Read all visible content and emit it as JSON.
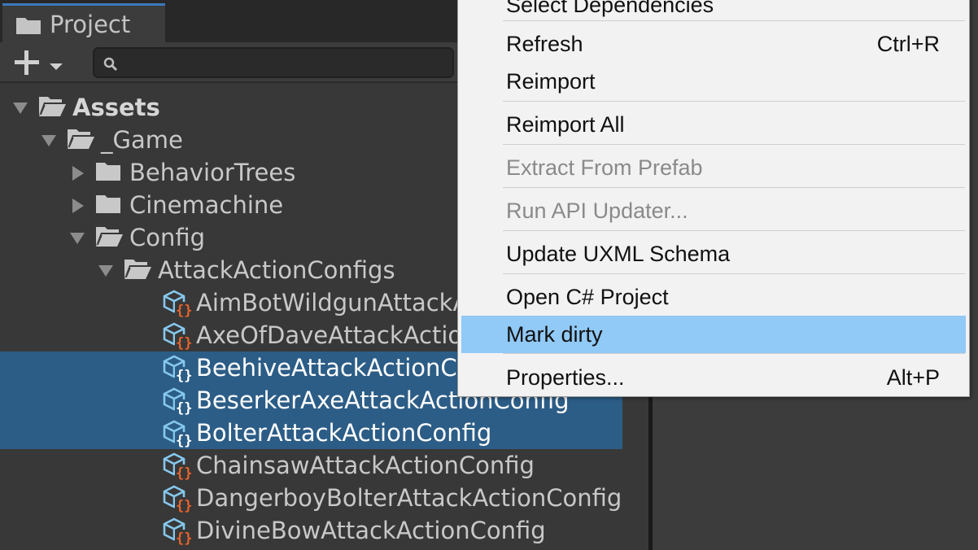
{
  "project_tab": {
    "label": "Project"
  },
  "toolbar": {
    "add_icon": "plus-icon",
    "search_placeholder": "",
    "search_value": ""
  },
  "tree": [
    {
      "label": "Assets",
      "depth": 0,
      "arrow": "expanded",
      "icon": "folder-open-icon",
      "bold": true,
      "selected": false
    },
    {
      "label": "_Game",
      "depth": 1,
      "arrow": "expanded",
      "icon": "folder-open-icon",
      "bold": false,
      "selected": false
    },
    {
      "label": "BehaviorTrees",
      "depth": 2,
      "arrow": "collapsed",
      "icon": "folder-icon",
      "bold": false,
      "selected": false
    },
    {
      "label": "Cinemachine",
      "depth": 2,
      "arrow": "collapsed",
      "icon": "folder-icon",
      "bold": false,
      "selected": false
    },
    {
      "label": "Config",
      "depth": 2,
      "arrow": "expanded",
      "icon": "folder-open-icon",
      "bold": false,
      "selected": false
    },
    {
      "label": "AttackActionConfigs",
      "depth": 3,
      "arrow": "expanded",
      "icon": "folder-open-icon",
      "bold": false,
      "selected": false
    },
    {
      "label": "AimBotWildgunAttackActionConfig",
      "depth": 4,
      "arrow": "none",
      "icon": "scriptable-object-icon",
      "bold": false,
      "selected": false
    },
    {
      "label": "AxeOfDaveAttackActionConfig",
      "depth": 4,
      "arrow": "none",
      "icon": "scriptable-object-icon",
      "bold": false,
      "selected": false
    },
    {
      "label": "BeehiveAttackActionConfig",
      "depth": 4,
      "arrow": "none",
      "icon": "scriptable-object-icon",
      "bold": false,
      "selected": true
    },
    {
      "label": "BeserkerAxeAttackActionConfig",
      "depth": 4,
      "arrow": "none",
      "icon": "scriptable-object-icon",
      "bold": false,
      "selected": true
    },
    {
      "label": "BolterAttackActionConfig",
      "depth": 4,
      "arrow": "none",
      "icon": "scriptable-object-icon",
      "bold": false,
      "selected": true
    },
    {
      "label": "ChainsawAttackActionConfig",
      "depth": 4,
      "arrow": "none",
      "icon": "scriptable-object-icon",
      "bold": false,
      "selected": false
    },
    {
      "label": "DangerboyBolterAttackActionConfig",
      "depth": 4,
      "arrow": "none",
      "icon": "scriptable-object-icon",
      "bold": false,
      "selected": false
    },
    {
      "label": "DivineBowAttackActionConfig",
      "depth": 4,
      "arrow": "none",
      "icon": "scriptable-object-icon",
      "bold": false,
      "selected": false
    }
  ],
  "context_menu": {
    "items": [
      {
        "label": "Select Dependencies",
        "shortcut": "",
        "disabled": false,
        "highlighted": false
      },
      {
        "label": "Refresh",
        "shortcut": "Ctrl+R",
        "disabled": false,
        "highlighted": false
      },
      {
        "label": "Reimport",
        "shortcut": "",
        "disabled": false,
        "highlighted": false
      },
      {
        "label": "Reimport All",
        "shortcut": "",
        "disabled": false,
        "highlighted": false
      },
      {
        "label": "Extract From Prefab",
        "shortcut": "",
        "disabled": true,
        "highlighted": false
      },
      {
        "label": "Run API Updater...",
        "shortcut": "",
        "disabled": true,
        "highlighted": false
      },
      {
        "label": "Update UXML Schema",
        "shortcut": "",
        "disabled": false,
        "highlighted": false
      },
      {
        "label": "Open C# Project",
        "shortcut": "",
        "disabled": false,
        "highlighted": false
      },
      {
        "label": "Mark dirty",
        "shortcut": "",
        "disabled": false,
        "highlighted": true
      },
      {
        "label": "Properties...",
        "shortcut": "Alt+P",
        "disabled": false,
        "highlighted": false
      }
    ]
  },
  "colors": {
    "panel_bg": "#383838",
    "selection": "#2c5d87",
    "menu_bg": "#f2f2f2",
    "menu_highlight": "#91c9f7",
    "script_icon_accent": "#e8632b",
    "icon_blue": "#7fc6f0"
  }
}
